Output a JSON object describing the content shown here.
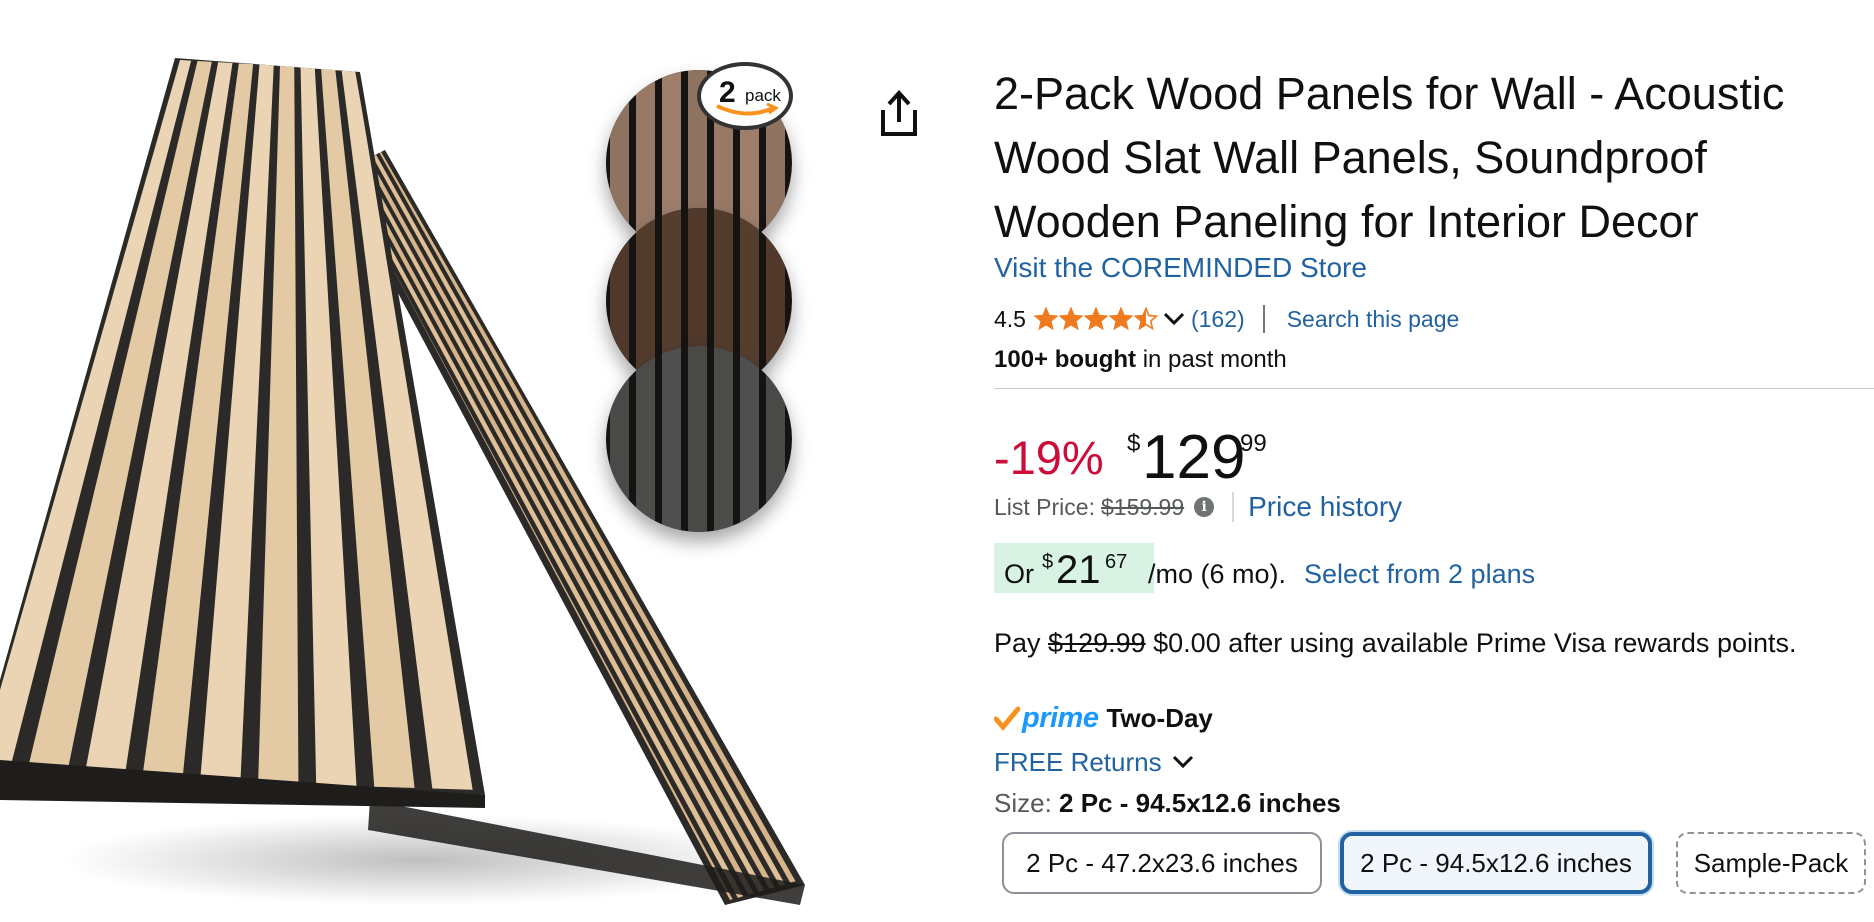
{
  "colors": {
    "link": "#2162a1",
    "discount": "#cc0c39",
    "star": "#f07a1f",
    "prime_blue": "#1a98ff",
    "prime_check": "#f7921e",
    "installment_bg": "#d8f3e4",
    "selected_border": "#2162a1"
  },
  "gallery": {
    "badge_number": "2",
    "badge_word": "pack",
    "share_icon": "share-icon"
  },
  "product": {
    "title": "2-Pack Wood Panels for Wall - Acoustic Wood Slat Wall Panels, Soundproof Wooden Paneling for Interior Decor",
    "store_link": "Visit the COREMINDED Store"
  },
  "rating": {
    "value": "4.5",
    "stars": 4.5,
    "count": "(162)",
    "search_link": "Search this page"
  },
  "purchases": {
    "bold": "100+ bought",
    "rest": " in past month"
  },
  "price": {
    "discount": "-19%",
    "symbol": "$",
    "whole": "129",
    "fraction": "99",
    "list_label": "List Price:",
    "list_value": "$159.99",
    "info_icon": "i",
    "history_link": "Price history"
  },
  "installment": {
    "or": "Or",
    "symbol": "$",
    "whole": "21",
    "fraction": "67",
    "term": "/mo (6 mo).",
    "plans_link": "Select from 2 plans"
  },
  "rewards": {
    "pay": "Pay ",
    "old_price": "$129.99",
    "rest": " $0.00 after using available Prime Visa rewards points."
  },
  "delivery": {
    "prime": "prime",
    "speed": "Two-Day",
    "returns": "FREE Returns"
  },
  "size": {
    "label": "Size: ",
    "selected": "2 Pc - 94.5x12.6 inches",
    "options": [
      "2 Pc - 47.2x23.6 inches",
      "2 Pc - 94.5x12.6 inches",
      "Sample-Pack"
    ]
  }
}
